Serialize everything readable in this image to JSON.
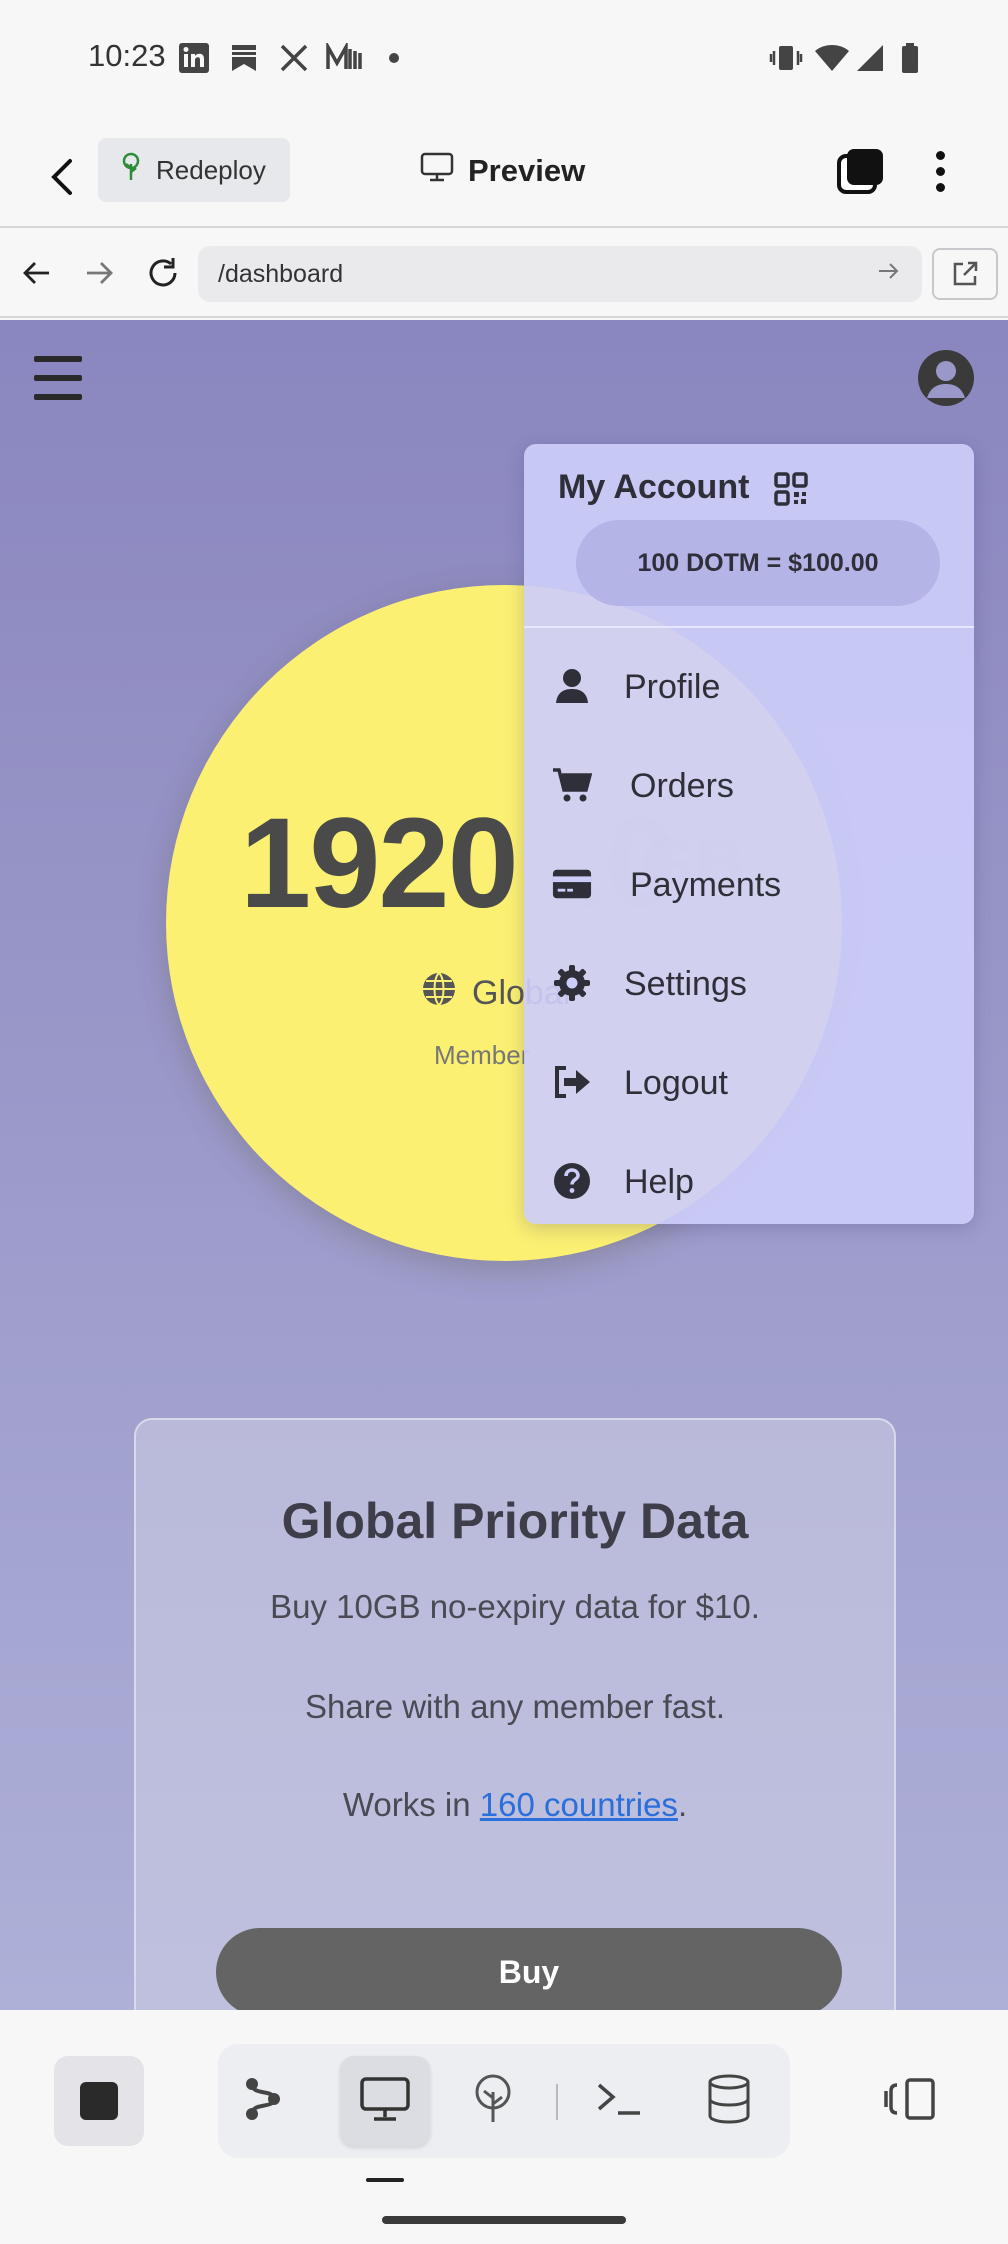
{
  "status_bar": {
    "time": "10:23",
    "notification_icons": [
      "linkedin-icon",
      "bookmark-app-icon",
      "x-icon",
      "medium-icon",
      "dot-icon"
    ],
    "system_icons": [
      "vibrate-icon",
      "wifi-icon",
      "signal-icon",
      "battery-icon"
    ]
  },
  "app_bar": {
    "redeploy_label": "Redeploy",
    "title": "Preview"
  },
  "browser": {
    "url": "/dashboard"
  },
  "dashboard": {
    "data_amount": "1920",
    "data_amount_hidden": ".0",
    "data_unit": "GB",
    "region_label": "Global",
    "member_label": "Member"
  },
  "card": {
    "title": "Global Priority Data",
    "line1": "Buy 10GB no-expiry data for $10.",
    "line2": "Share with any member fast.",
    "line3_prefix": "Works in ",
    "line3_link": "160 countries",
    "line3_suffix": ".",
    "buy_label": "Buy"
  },
  "account_menu": {
    "title": "My Account",
    "balance": "100 DOTM = $100.00",
    "items": [
      {
        "label": "Profile",
        "icon": "user-icon"
      },
      {
        "label": "Orders",
        "icon": "cart-icon"
      },
      {
        "label": "Payments",
        "icon": "credit-card-icon"
      },
      {
        "label": "Settings",
        "icon": "gear-icon"
      },
      {
        "label": "Logout",
        "icon": "logout-icon"
      },
      {
        "label": "Help",
        "icon": "help-icon"
      }
    ]
  },
  "bottom_toolbar": {
    "tools": [
      "stop-icon",
      "workflow-icon",
      "desktop-icon",
      "deploy-icon",
      "terminal-icon",
      "database-icon",
      "panel-icon"
    ]
  },
  "colors": {
    "page_bg": "#8a86bf",
    "yellow_circle": "#fbf072",
    "menu_bg": "#cdcdfa",
    "link": "#2a6fdb",
    "buy_button": "#646464"
  }
}
